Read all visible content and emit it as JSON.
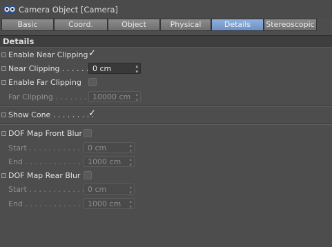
{
  "window": {
    "title": "Camera Object [Camera]",
    "icon": "camera-object-icon"
  },
  "tabs": [
    {
      "label": "Basic",
      "active": false
    },
    {
      "label": "Coord.",
      "active": false
    },
    {
      "label": "Object",
      "active": false
    },
    {
      "label": "Physical",
      "active": false
    },
    {
      "label": "Details",
      "active": true
    },
    {
      "label": "Stereoscopic",
      "active": false
    }
  ],
  "section": {
    "title": "Details"
  },
  "near": {
    "enable_label": "Enable Near Clipping",
    "enable_checked": true,
    "clip_label": "Near Clipping",
    "clip_dots": ". . . . . .",
    "clip_value": "0 cm"
  },
  "far": {
    "enable_label": "Enable Far Clipping",
    "enable_checked": false,
    "clip_label": "Far Clipping",
    "clip_dots": ". . . . . . . .",
    "clip_value": "10000 cm"
  },
  "cone": {
    "label": "Show Cone",
    "dots": ". . . . . . . . .",
    "checked": true
  },
  "dof_front": {
    "label": "DOF Map Front Blur",
    "checked": false,
    "start_label": "Start",
    "start_dots": ". . . . . . . . . . . . .",
    "start_value": "0 cm",
    "end_label": "End",
    "end_dots": ". . . . . . . . . . . . . .",
    "end_value": "1000 cm"
  },
  "dof_rear": {
    "label": "DOF Map Rear Blur",
    "checked": false,
    "start_label": "Start",
    "start_dots": ". . . . . . . . . . . . .",
    "start_value": "0 cm",
    "end_label": "End",
    "end_dots": ". . . . . . . . . . . . . .",
    "end_value": "1000 cm"
  },
  "glyphs": {
    "checkmark": "✓",
    "stepper": "▲▼"
  }
}
